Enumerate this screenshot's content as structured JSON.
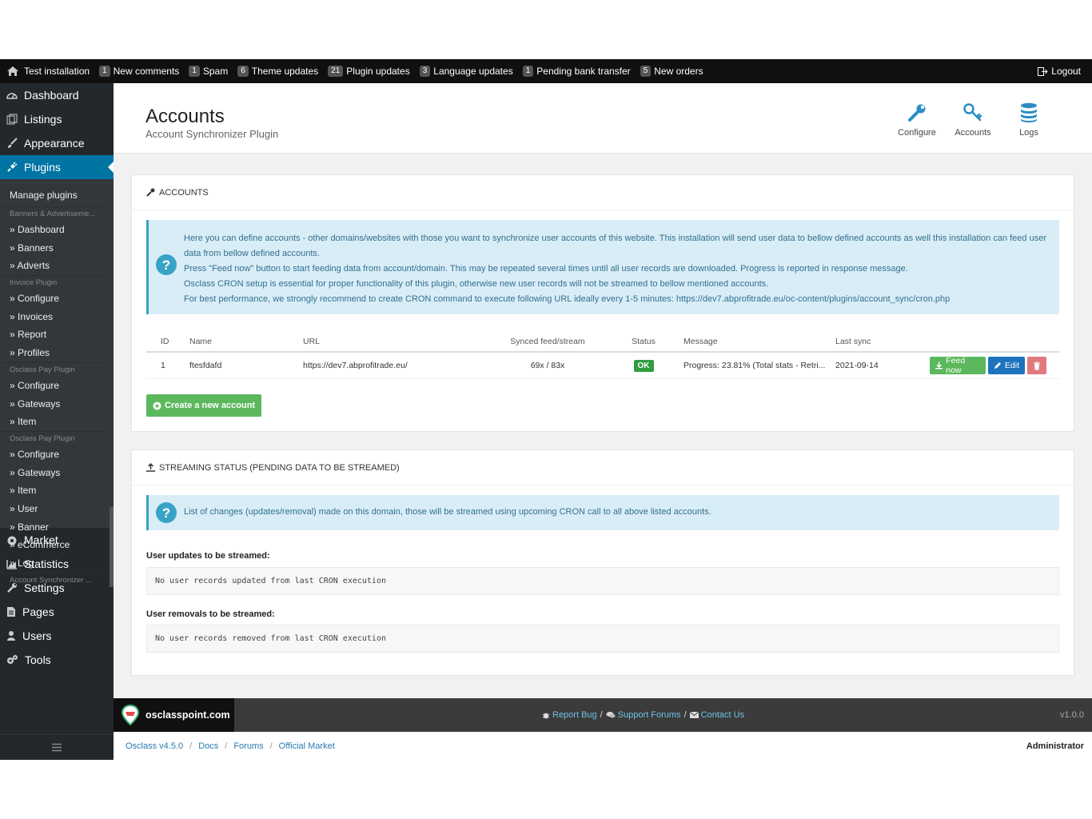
{
  "topbar": {
    "home": "Test installation",
    "items": [
      {
        "count": "1",
        "label": "New comments"
      },
      {
        "count": "1",
        "label": "Spam"
      },
      {
        "count": "6",
        "label": "Theme updates"
      },
      {
        "count": "21",
        "label": "Plugin updates"
      },
      {
        "count": "3",
        "label": "Language updates"
      },
      {
        "count": "1",
        "label": "Pending bank transfer"
      },
      {
        "count": "5",
        "label": "New orders"
      }
    ],
    "logout": "Logout"
  },
  "sidebar": {
    "top_items": [
      "Dashboard",
      "Listings",
      "Appearance",
      "Plugins"
    ],
    "submenu": {
      "manage": "Manage plugins",
      "groups": [
        {
          "title": "Banners & Advertiseme...",
          "items": [
            "» Dashboard",
            "» Banners",
            "» Adverts"
          ]
        },
        {
          "title": "Invoice Plugin",
          "items": [
            "» Configure",
            "» Invoices",
            "» Report",
            "» Profiles"
          ]
        },
        {
          "title": "Osclass Pay Plugin",
          "items": [
            "» Configure",
            "» Gateways",
            "» Item"
          ]
        },
        {
          "title": "Osclass Pay Plugin",
          "items": [
            "» Configure",
            "» Gateways",
            "» Item",
            "» User",
            "» Banner",
            "» eCommerce",
            "» Log"
          ]
        },
        {
          "title": "Account Synchronizer ...",
          "items": []
        }
      ]
    },
    "bottom_items": [
      "Market",
      "Statistics",
      "Settings",
      "Pages",
      "Users",
      "Tools"
    ]
  },
  "header": {
    "title": "Accounts",
    "subtitle": "Account Synchronizer Plugin",
    "actions": [
      "Configure",
      "Accounts",
      "Logs"
    ]
  },
  "accounts_panel": {
    "title": "Accounts",
    "info_lines": [
      "Here you can define accounts - other domains/websites with those you want to synchronize user accounts of this website. This installation will send user data to bellow defined accounts as well this installation can feed user data from bellow defined accounts.",
      "Press \"Feed now\" button to start feeding data from account/domain. This may be repeated several times until all user records are downloaded. Progress is reported in response message.",
      "Osclass CRON setup is essential for proper functionality of this plugin, otherwise new user records will not be streamed to bellow mentioned accounts.",
      "For best performance, we strongly recommend to create CRON command to execute following URL ideally every 1-5 minutes: https://dev7.abprofitrade.eu/oc-content/plugins/account_sync/cron.php"
    ],
    "columns": [
      "ID",
      "Name",
      "URL",
      "Synced feed/stream",
      "Status",
      "Message",
      "Last sync"
    ],
    "rows": [
      {
        "id": "1",
        "name": "ftesfdafd",
        "url": "https://dev7.abprofitrade.eu/",
        "synced": "69x / 83x",
        "status": "OK",
        "message": "Progress: 23.81% (Total stats - Retri...",
        "last_sync": "2021-09-14"
      }
    ],
    "feed_now": "Feed now",
    "edit": "Edit",
    "create": "Create a new account"
  },
  "streaming_panel": {
    "title": "Streaming status (pending data to be streamed)",
    "info": "List of changes (updates/removal) made on this domain, those will be streamed using upcoming CRON call to all above listed accounts.",
    "updates_label": "User updates to be streamed:",
    "updates_value": "No user records updated from last CRON execution",
    "removals_label": "User removals to be streamed:",
    "removals_value": "No user records removed from last CRON execution"
  },
  "footer": {
    "brand": "osclasspoint.com",
    "report_bug": "Report Bug",
    "support": "Support Forums",
    "contact": "Contact Us",
    "version": "v1.0.0"
  },
  "bottombar": {
    "crumbs": [
      "Osclass v4.5.0",
      "Docs",
      "Forums",
      "Official Market"
    ],
    "user": "Administrator"
  }
}
